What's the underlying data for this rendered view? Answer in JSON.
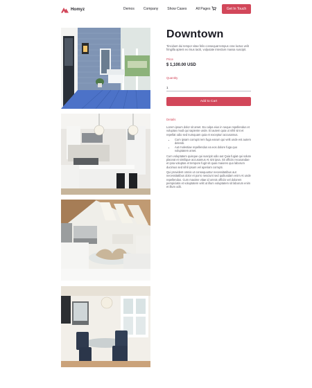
{
  "brand": {
    "name": "Homyz",
    "logo_icon": "house-roof-logo",
    "accent_color": "#d2475a"
  },
  "nav": {
    "links": [
      "Demos",
      "Company",
      "Show Cases",
      "All Pages"
    ],
    "cart_icon": "cart-icon",
    "cta_label": "Get In Touch"
  },
  "gallery": {
    "images": [
      "porch-photo",
      "kitchen-photo",
      "attic-living-room-photo",
      "dining-room-photo"
    ]
  },
  "product": {
    "title": "Downtown",
    "description": "Tincidunt dui tempor vitae felis consequat tempus cras luctus velit fringilla aptent ex risus taciti, vulputate interdum massa suscipit.",
    "price_label": "Price",
    "price": "$ 1,100.00 USD",
    "quantity_label": "Quantity",
    "quantity_value": "1",
    "add_to_cart_label": "Add to Cart"
  },
  "details": {
    "label": "Details",
    "intro": "Lorem ipsum dolor sit amet. Ea culpa eius in neque repellendus et voluptas modi qui sapiente unde. Et autem quia ut nihil sint et repellat odio sed numquam quia et excepturi accusamus.",
    "bullets": [
      "Cum ipsam corrupti rem fuga earum qui velit unde est autem deleniti.",
      "Aut molestiae repellendus ea eos dolore fuga quo voluptatem amet."
    ],
    "paragraph_2": "Cum voluptatem quisque qui suscipit odio aut Quia fugiat qui solute placeat et similique accusamus At sint ipsa. Sit officiis recusandae et ipsa voluptas et tempore fugit sit quas maiores quo laborum ducimus sed nihil ipsum vel aperiam corrupti.",
    "paragraph_3": "Qui provident omnis ut consequuntur necessitatibus aut necessitatibus dolor et porro nesciunt sed quibusdam enim At unde repellendus. Cum maxime vitae id omnis officiis vel dolorem perspiciatis et voluptatem velit ut illum voluptatem sit laborum enim et illum odit."
  }
}
